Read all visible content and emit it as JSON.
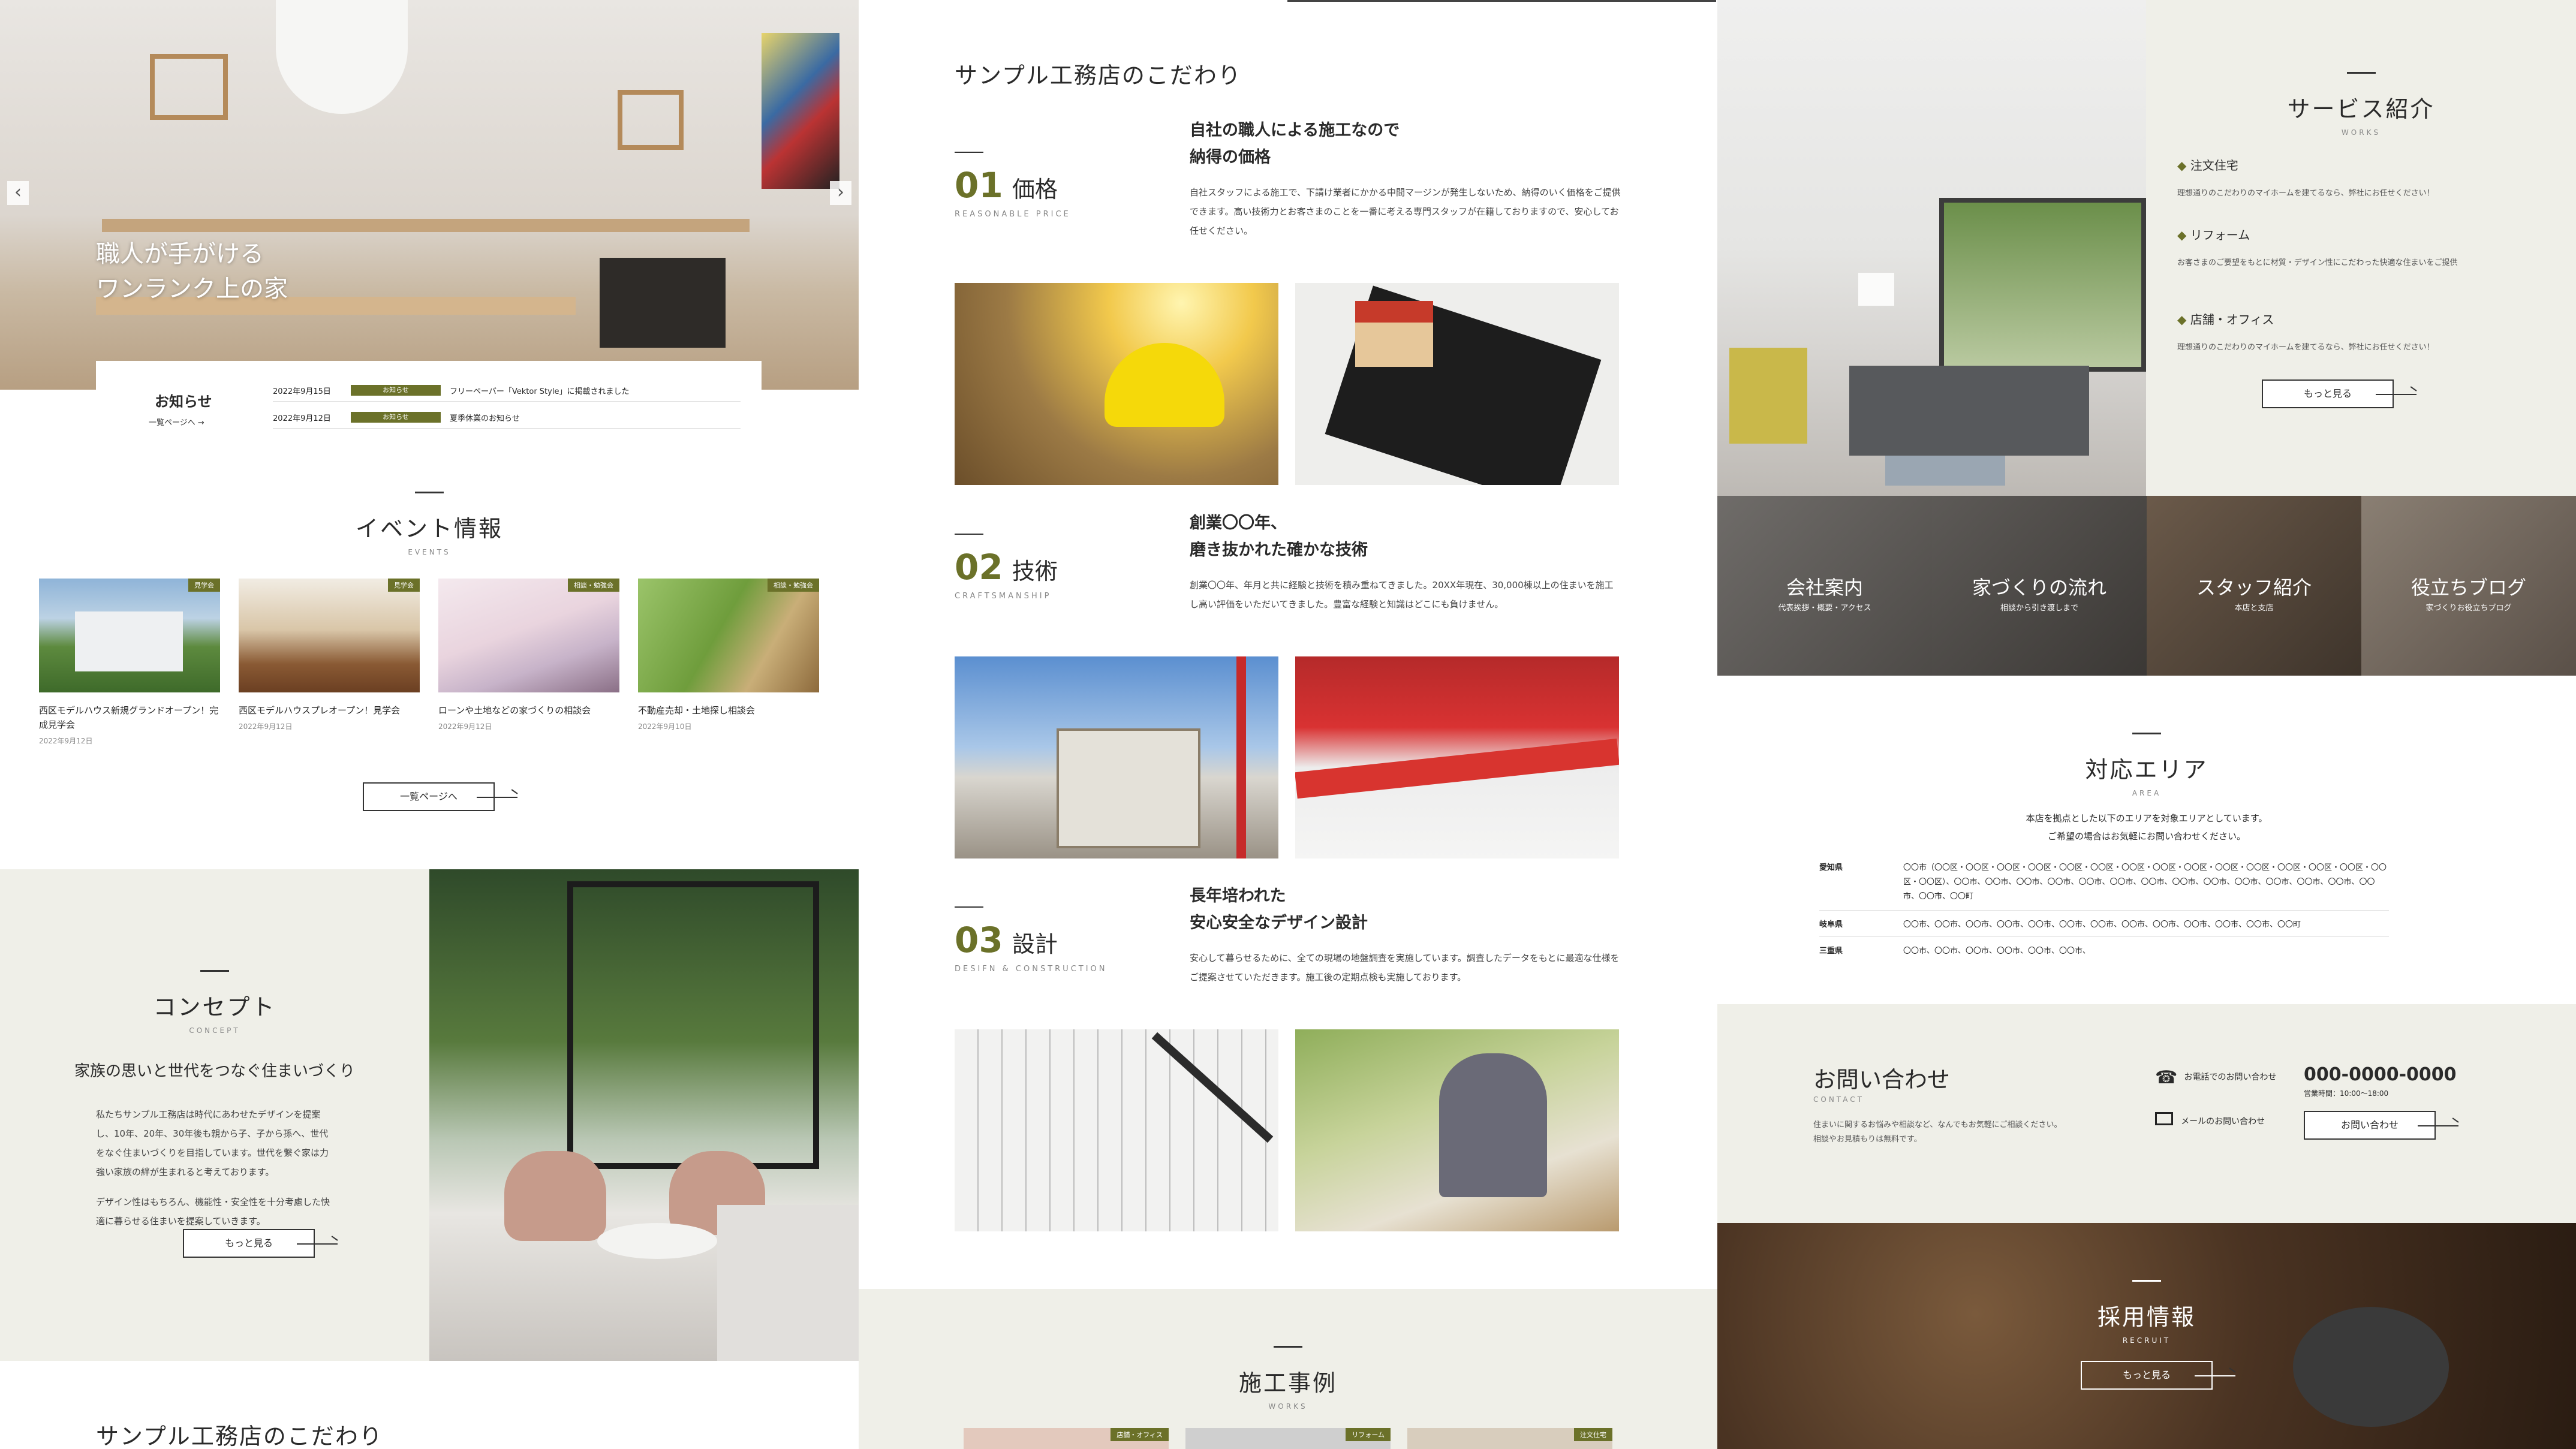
{
  "hero": {
    "headline_line1": "職人が手がける",
    "headline_line2": "ワンランク上の家",
    "prev_arrow": "‹",
    "next_arrow": "›"
  },
  "news": {
    "title": "お知らせ",
    "list_link": "一覧ページへ",
    "items": [
      {
        "date": "2022年9月15日",
        "badge": "お知らせ",
        "text": "フリーペーパー「Vektor Style」に掲載されました"
      },
      {
        "date": "2022年9月12日",
        "badge": "お知らせ",
        "text": "夏季休業のお知らせ"
      }
    ]
  },
  "events": {
    "title": "イベント情報",
    "sub": "EVENTS",
    "items": [
      {
        "tag": "見学会",
        "title": "西区モデルハウス新規グランドオープン！完成見学会",
        "date": "2022年9月12日"
      },
      {
        "tag": "見学会",
        "title": "西区モデルハウスプレオープン！見学会",
        "date": "2022年9月12日"
      },
      {
        "tag": "相談・勉強会",
        "title": "ローンや土地などの家づくりの相談会",
        "date": "2022年9月12日"
      },
      {
        "tag": "相談・勉強会",
        "title": "不動産売却・土地探し相談会",
        "date": "2022年9月10日"
      }
    ],
    "button": "一覧ページへ"
  },
  "concept": {
    "title": "コンセプト",
    "sub": "CONCEPT",
    "heading": "家族の思いと世代をつなぐ住まいづくり",
    "para1": "私たちサンプル工務店は時代にあわせたデザインを提案し、10年、20年、30年後も親から子、子から孫へ、世代をなぐ住まいづくりを目指しています。世代を繋ぐ家は力強い家族の絆が生まれると考えております。",
    "para2": "デザイン性はもちろん、機能性・安全性を十分考慮した快適に暮らせる住まいを提案していきます。",
    "button": "もっと見る"
  },
  "commit_bottom_title": "サンプル工務店のこだわり",
  "commit": {
    "title": "サンプル工務店のこだわり",
    "items": [
      {
        "num": "01",
        "label": "価格",
        "en": "REASONABLE PRICE",
        "head1": "自社の職人による施工なので",
        "head2": "納得の価格",
        "body": "自社スタッフによる施工で、下請け業者にかかる中間マージンが発生しないため、納得のいく価格をご提供できます。高い技術力とお客さまのことを一番に考える専門スタッフが在籍しておりますので、安心してお任せください。"
      },
      {
        "num": "02",
        "label": "技術",
        "en": "CRAFTSMANSHIP",
        "head1": "創業〇〇年、",
        "head2": "磨き抜かれた確かな技術",
        "body": "創業〇〇年、年月と共に経験と技術を積み重ねてきました。20XX年現在、30,000棟以上の住まいを施工し高い評価をいただいてきました。豊富な経験と知識はどこにも負けません。"
      },
      {
        "num": "03",
        "label": "設計",
        "en": "DESIFN & CONSTRUCTION",
        "head1": "長年培われた",
        "head2": "安心安全なデザイン設計",
        "body": "安心して暮らせるために、全ての現場の地盤調査を実施しています。調査したデータをもとに最適な仕様をご提案させていただきます。施工後の定期点検も実施しております。"
      }
    ]
  },
  "works": {
    "title": "施工事例",
    "sub": "WORKS",
    "tags": [
      "店舗・オフィス",
      "リフォーム",
      "注文住宅"
    ]
  },
  "services": {
    "title": "サービス紹介",
    "sub": "WORKS",
    "items": [
      {
        "name": "注文住宅",
        "desc": "理想通りのこだわりのマイホームを建てるなら、弊社にお任せください！"
      },
      {
        "name": "リフォーム",
        "desc": "お客さまのご要望をもとに材質・デザイン性にこだわった快適な住まいをご提供"
      },
      {
        "name": "店舗・オフィス",
        "desc": "理想通りのこだわりのマイホームを建てるなら、弊社にお任せください！"
      }
    ],
    "button": "もっと見る"
  },
  "tiles": [
    {
      "title": "会社案内",
      "sub": "代表挨拶・概要・アクセス"
    },
    {
      "title": "家づくりの流れ",
      "sub": "相談から引き渡しまで"
    },
    {
      "title": "スタッフ紹介",
      "sub": "本店と支店"
    },
    {
      "title": "役立ちブログ",
      "sub": "家づくりお役立ちブログ"
    }
  ],
  "area": {
    "title": "対応エリア",
    "sub": "AREA",
    "intro1": "本店を拠点とした以下のエリアを対象エリアとしています。",
    "intro2": "ご希望の場合はお気軽にお問い合わせください。",
    "rows": [
      {
        "pref": "愛知県",
        "cities": "〇〇市（〇〇区・〇〇区・〇〇区・〇〇区・〇〇区・〇〇区・〇〇区・〇〇区・〇〇区・〇〇区・〇〇区・〇〇区・〇〇区・〇〇区・〇〇区・〇〇区）、〇〇市、〇〇市、〇〇市、〇〇市、〇〇市、〇〇市、〇〇市、〇〇市、〇〇市、〇〇市、〇〇市、〇〇市、〇〇市、〇〇市、〇〇市、〇〇町"
      },
      {
        "pref": "岐阜県",
        "cities": "〇〇市、〇〇市、〇〇市、〇〇市、〇〇市、〇〇市、〇〇市、〇〇市、〇〇市、〇〇市、〇〇市、〇〇市、〇〇町"
      },
      {
        "pref": "三重県",
        "cities": "〇〇市、〇〇市、〇〇市、〇〇市、〇〇市、〇〇市、"
      }
    ]
  },
  "contact": {
    "title": "お問い合わせ",
    "sub": "CONTACT",
    "desc1": "住まいに関するお悩みや相談など、なんでもお気軽にご相談ください。",
    "desc2": "相談やお見積もりは無料です。",
    "phone_label": "お電話でのお問い合わせ",
    "phone": "000-0000-0000",
    "hours": "営業時間：10:00〜18:00",
    "mail_label": "メールのお問い合わせ",
    "button": "お問い合わせ"
  },
  "recruit": {
    "title": "採用情報",
    "sub": "RECRUIT",
    "button": "もっと見る"
  },
  "colors": {
    "accent": "#6b7129",
    "beige": "#efefe8"
  }
}
